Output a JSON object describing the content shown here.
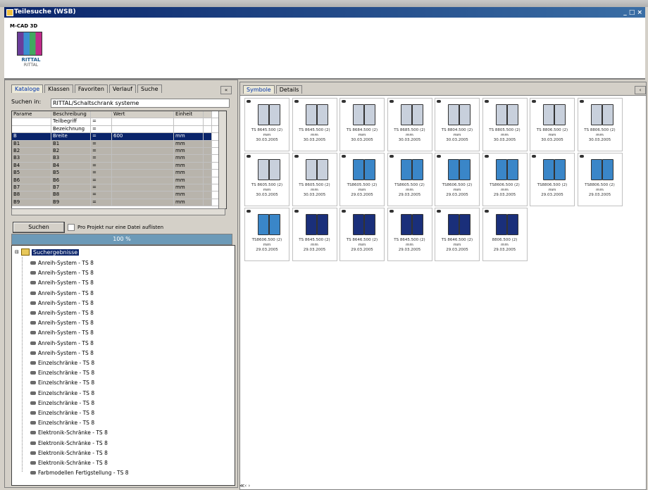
{
  "window": {
    "title": "Teilesuche (WSB)",
    "controls": "_ □ ×"
  },
  "logo": {
    "line1": "M-CAD 3D",
    "brand": "RITTAL",
    "sub": "RITTAL"
  },
  "left": {
    "tabs": [
      "Kataloge",
      "Klassen",
      "Favoriten",
      "Verlauf",
      "Suche"
    ],
    "active_tab": 0,
    "search_label": "Suchen in:",
    "search_value": "RITTAL/Schaltschrank systeme",
    "grid": {
      "headers": [
        "Parame",
        "Beschreibung",
        "",
        "Wert",
        "Einheit",
        ""
      ],
      "rows": [
        [
          "",
          "Teilbegriff",
          "=",
          "",
          "",
          ""
        ],
        [
          "",
          "Bezeichnung",
          "=",
          "",
          "",
          ""
        ],
        [
          "B",
          "Breite",
          "=",
          "600",
          "mm",
          ""
        ],
        [
          "B1",
          "B1",
          "=",
          "",
          "mm",
          ""
        ],
        [
          "B2",
          "B2",
          "=",
          "",
          "mm",
          ""
        ],
        [
          "B3",
          "B3",
          "=",
          "",
          "mm",
          ""
        ],
        [
          "B4",
          "B4",
          "=",
          "",
          "mm",
          ""
        ],
        [
          "B5",
          "B5",
          "=",
          "",
          "mm",
          ""
        ],
        [
          "B6",
          "B6",
          "=",
          "",
          "mm",
          ""
        ],
        [
          "B7",
          "B7",
          "=",
          "",
          "mm",
          ""
        ],
        [
          "B8",
          "B8",
          "=",
          "",
          "mm",
          ""
        ],
        [
          "B9",
          "B9",
          "=",
          "",
          "mm",
          ""
        ]
      ],
      "selected_row": 2
    },
    "search_button": "Suchen",
    "checkbox_label": "Pro Projekt nur eine Datei auflisten",
    "progress_text": "100 %",
    "tree": {
      "root": "Suchergebnisse",
      "items": [
        "Anreih-System - TS 8",
        "Anreih-System - TS 8",
        "Anreih-System - TS 8",
        "Anreih-System - TS 8",
        "Anreih-System - TS 8",
        "Anreih-System - TS 8",
        "Anreih-System - TS 8",
        "Anreih-System - TS 8",
        "Anreih-System - TS 8",
        "Anreih-System - TS 8",
        "Einzelschränke - TS 8",
        "Einzelschränke - TS 8",
        "Einzelschränke - TS 8",
        "Einzelschränke - TS 8",
        "Einzelschränke - TS 8",
        "Einzelschränke - TS 8",
        "Einzelschränke - TS 8",
        "Elektronik-Schränke - TS 8",
        "Elektronik-Schränke - TS 8",
        "Elektronik-Schränke - TS 8",
        "Elektronik-Schränke - TS 8",
        "Farbmodellen Fertigstellung - TS 8"
      ]
    }
  },
  "right": {
    "tabs": [
      "Symbole",
      "Details"
    ],
    "thumbnails": [
      {
        "code": "TS 8645.500 (2)",
        "unit": "mm",
        "date": "30.03.2005",
        "style": "gray"
      },
      {
        "code": "TS 8645.500 (2)",
        "unit": "mm",
        "date": "30.03.2005",
        "style": "gray"
      },
      {
        "code": "TS 8684.500 (2)",
        "unit": "mm",
        "date": "30.03.2005",
        "style": "gray"
      },
      {
        "code": "TS 8685.500 (2)",
        "unit": "mm",
        "date": "30.03.2005",
        "style": "gray"
      },
      {
        "code": "TS 8804.500 (2)",
        "unit": "mm",
        "date": "30.03.2005",
        "style": "gray"
      },
      {
        "code": "TS 8805.500 (2)",
        "unit": "mm",
        "date": "30.03.2005",
        "style": "gray"
      },
      {
        "code": "TS 8806.500 (2)",
        "unit": "mm",
        "date": "30.03.2005",
        "style": "gray"
      },
      {
        "code": "TS 8806.500 (2)",
        "unit": "mm",
        "date": "30.03.2005",
        "style": "gray"
      },
      {
        "code": "TS 8605.500 (2)",
        "unit": "mm",
        "date": "30.03.2005",
        "style": "gray"
      },
      {
        "code": "TS 8605.500 (2)",
        "unit": "mm",
        "date": "30.03.2005",
        "style": "gray"
      },
      {
        "code": "TS8605.500 (2)",
        "unit": "mm",
        "date": "29.03.2005",
        "style": "blue"
      },
      {
        "code": "TS8605.500 (2)",
        "unit": "mm",
        "date": "29.03.2005",
        "style": "blue"
      },
      {
        "code": "TS8606.500 (2)",
        "unit": "mm",
        "date": "29.03.2005",
        "style": "blue"
      },
      {
        "code": "TS8606.500 (2)",
        "unit": "mm",
        "date": "29.03.2005",
        "style": "blue"
      },
      {
        "code": "TS8806.500 (2)",
        "unit": "mm",
        "date": "29.03.2005",
        "style": "blue"
      },
      {
        "code": "TS8806.500 (2)",
        "unit": "mm",
        "date": "29.03.2005",
        "style": "blue"
      },
      {
        "code": "TS8606.500 (2)",
        "unit": "mm",
        "date": "29.03.2005",
        "style": "blue"
      },
      {
        "code": "TS 8645.500 (2)",
        "unit": "mm",
        "date": "29.03.2005",
        "style": "navy"
      },
      {
        "code": "TS 8646.500 (2)",
        "unit": "mm",
        "date": "29.03.2005",
        "style": "navy"
      },
      {
        "code": "TS 8645.500 (2)",
        "unit": "mm",
        "date": "29.03.2005",
        "style": "navy"
      },
      {
        "code": "TS 8646.500 (2)",
        "unit": "mm",
        "date": "29.03.2005",
        "style": "navy"
      },
      {
        "code": "8806.500 (2)",
        "unit": "mm",
        "date": "29.03.2005",
        "style": "navy"
      }
    ],
    "status": "≪‹ ›"
  },
  "colors": {
    "gray": "#c8d0dc",
    "blue": "#3a86c8",
    "navy": "#1a2f7a"
  }
}
